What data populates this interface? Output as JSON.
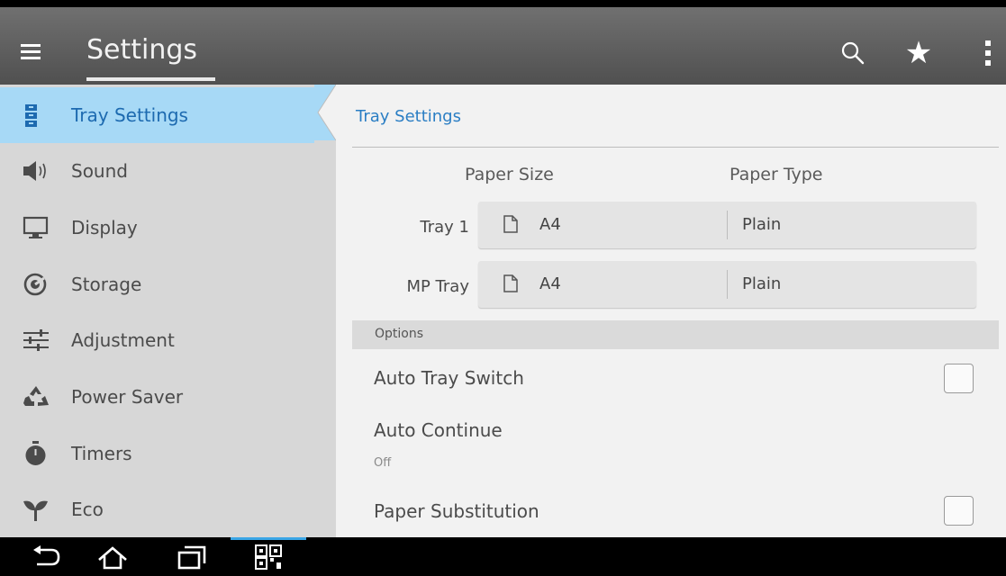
{
  "app_bar": {
    "title": "Settings",
    "menu_icon": "hamburger-menu-icon",
    "actions": [
      {
        "name": "search",
        "icon": "search-icon"
      },
      {
        "name": "favorite",
        "icon": "star-icon"
      },
      {
        "name": "more",
        "icon": "more-vert-icon"
      }
    ]
  },
  "sidebar": {
    "selected_index": 0,
    "items": [
      {
        "label": "Tray Settings",
        "icon": "tray-icon"
      },
      {
        "label": "Sound",
        "icon": "speaker-icon"
      },
      {
        "label": "Display",
        "icon": "monitor-icon"
      },
      {
        "label": "Storage",
        "icon": "storage-icon"
      },
      {
        "label": "Adjustment",
        "icon": "sliders-icon"
      },
      {
        "label": "Power Saver",
        "icon": "recycle-icon"
      },
      {
        "label": "Timers",
        "icon": "stopwatch-icon"
      },
      {
        "label": "Eco",
        "icon": "leaf-icon"
      }
    ]
  },
  "main": {
    "title": "Tray Settings",
    "columns": {
      "paper_size": "Paper Size",
      "paper_type": "Paper Type"
    },
    "trays": [
      {
        "label": "Tray 1",
        "paper_size": "A4",
        "paper_type": "Plain"
      },
      {
        "label": "MP Tray",
        "paper_size": "A4",
        "paper_type": "Plain"
      }
    ],
    "options_header": "Options",
    "options": [
      {
        "label": "Auto Tray Switch",
        "type": "checkbox",
        "checked": false
      },
      {
        "label": "Auto Continue",
        "value": "Off"
      },
      {
        "label": "Paper Substitution",
        "type": "checkbox",
        "checked": false
      }
    ]
  },
  "system_nav": {
    "buttons": [
      {
        "icon": "back-icon"
      },
      {
        "icon": "home-icon"
      },
      {
        "icon": "recent-apps-icon"
      },
      {
        "icon": "qr-scan-icon"
      }
    ]
  },
  "colors": {
    "accent": "#2b7ec4",
    "selected_bg": "#a7d9f6",
    "sidebar_bg": "#d7d7d7",
    "content_bg": "#f2f2f2",
    "app_bar": "#5f5f5f",
    "system_nav_indicator": "#3aa6e6"
  }
}
